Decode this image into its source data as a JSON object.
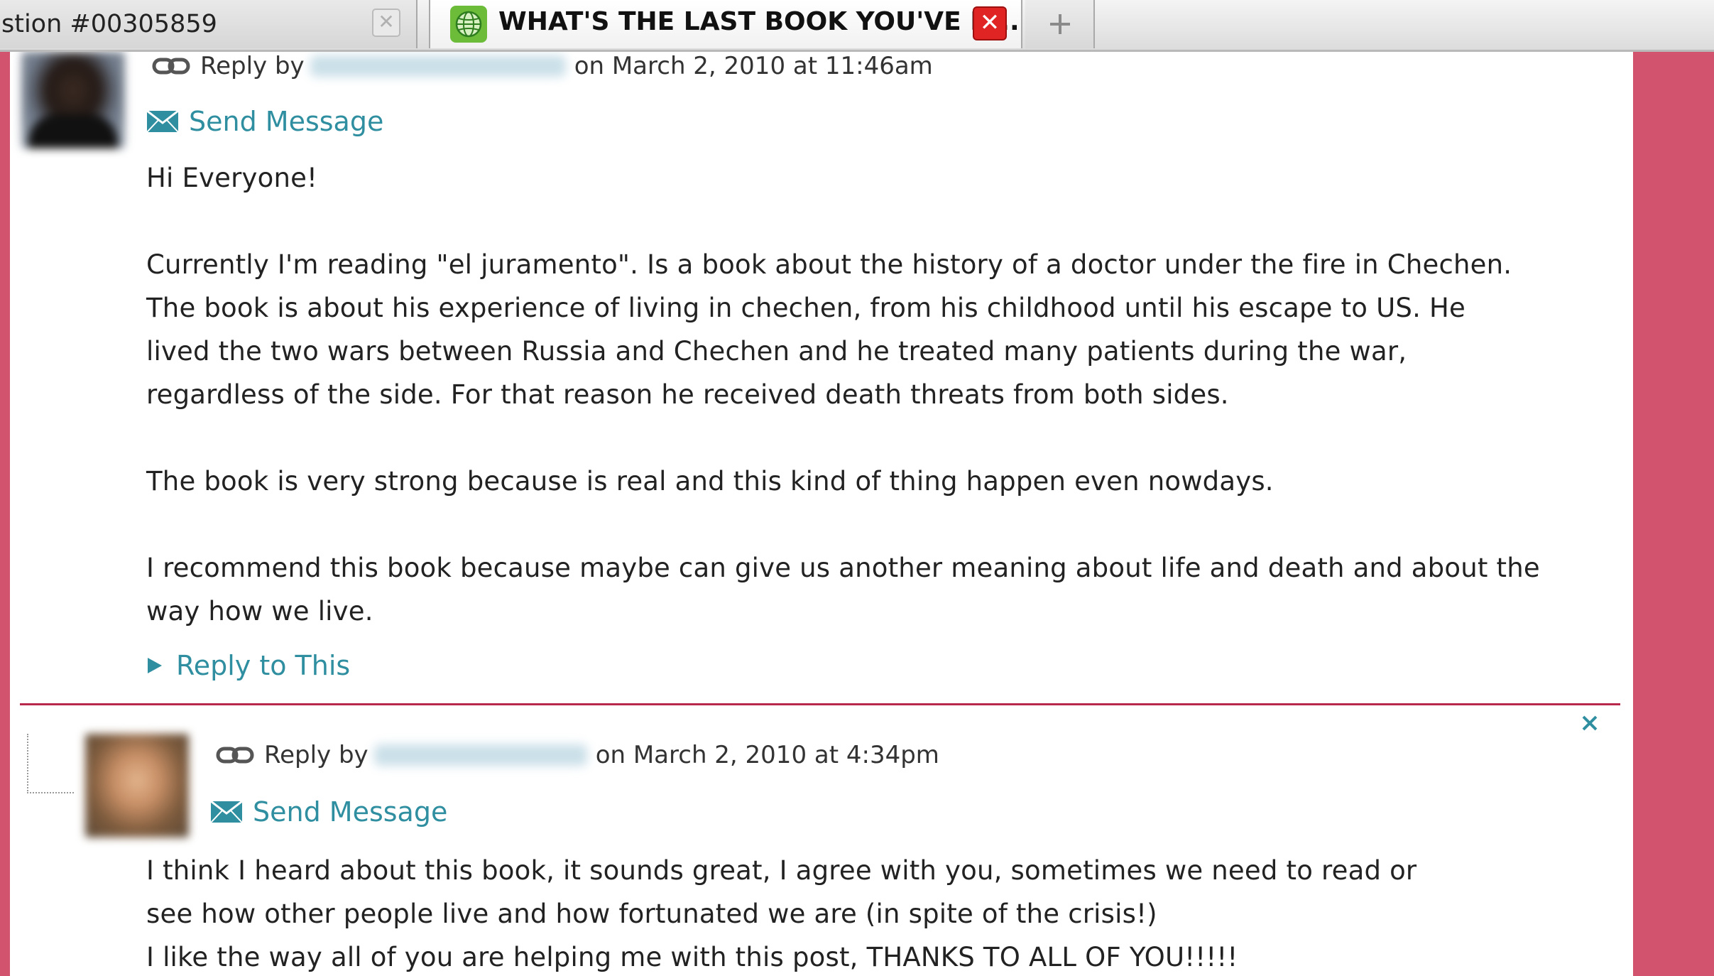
{
  "tabs": [
    {
      "title": "stion #00305859",
      "close_glyph": "✕",
      "active": false
    },
    {
      "title": "WHAT'S THE LAST BOOK YOU'VE R...",
      "icon": "globe-icon",
      "close_glyph": "✕",
      "active": true
    }
  ],
  "new_tab_icon": "plus-icon",
  "colors": {
    "accent": "#d2536e",
    "link": "#2f8fa0",
    "divider": "#b8284a",
    "close_active": "#e02323"
  },
  "posts": [
    {
      "reply_by_label": "Reply by",
      "author": "[blurred]",
      "date_text": "on March 2, 2010 at 11:46am",
      "send_message": "Send Message",
      "body": [
        "Hi Everyone!",
        "",
        "Currently I'm reading \"el juramento\". Is a book about the history of a doctor under the fire in Chechen.",
        "The book is about his experience of living in chechen, from his childhood until his escape to US. He",
        "lived the two wars between Russia and Chechen and he treated many patients during the war,",
        "regardless of the side. For that reason he received death threats from both sides.",
        "",
        "The book is very strong because is real and this kind of thing happen even nowdays.",
        "",
        "I recommend this book because maybe can give us another meaning about life and death and about the",
        "way how we live."
      ],
      "reply_to_this": "Reply to This"
    },
    {
      "reply_by_label": "Reply by",
      "author": "[blurred]",
      "date_text": "on March 2, 2010 at 4:34pm",
      "send_message": "Send Message",
      "body": [
        "I think I heard about this book, it sounds great, I agree with you, sometimes we need to read or",
        "see how other people live and how fortunated we are (in spite of the crisis!)",
        "I like the way all of you are helping me with this post, THANKS TO ALL OF YOU!!!!!"
      ]
    }
  ]
}
